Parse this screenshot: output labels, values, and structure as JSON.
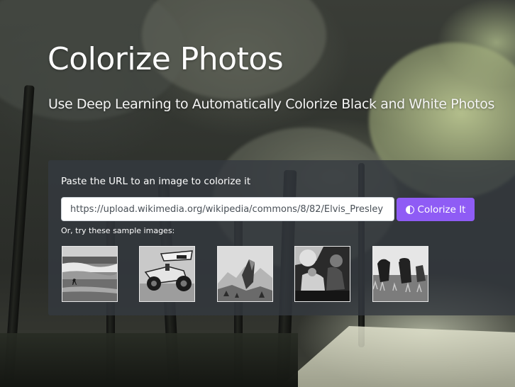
{
  "hero": {
    "title": "Colorize Photos",
    "subtitle": "Use Deep Learning to Automatically Colorize Black and White Photos"
  },
  "form": {
    "label": "Paste the URL to an image to colorize it",
    "url_value": "https://upload.wikimedia.org/wikipedia/commons/8/82/Elvis_Presley",
    "button_label": "Colorize It",
    "button_icon": "half-circle-icon",
    "button_color": "#8f5cf5"
  },
  "samples": {
    "label": "Or, try these sample images:",
    "images": [
      {
        "name": "bird-on-beach"
      },
      {
        "name": "sprint-car"
      },
      {
        "name": "rocky-mountain"
      },
      {
        "name": "people-sitting"
      },
      {
        "name": "cows-in-field"
      }
    ]
  }
}
